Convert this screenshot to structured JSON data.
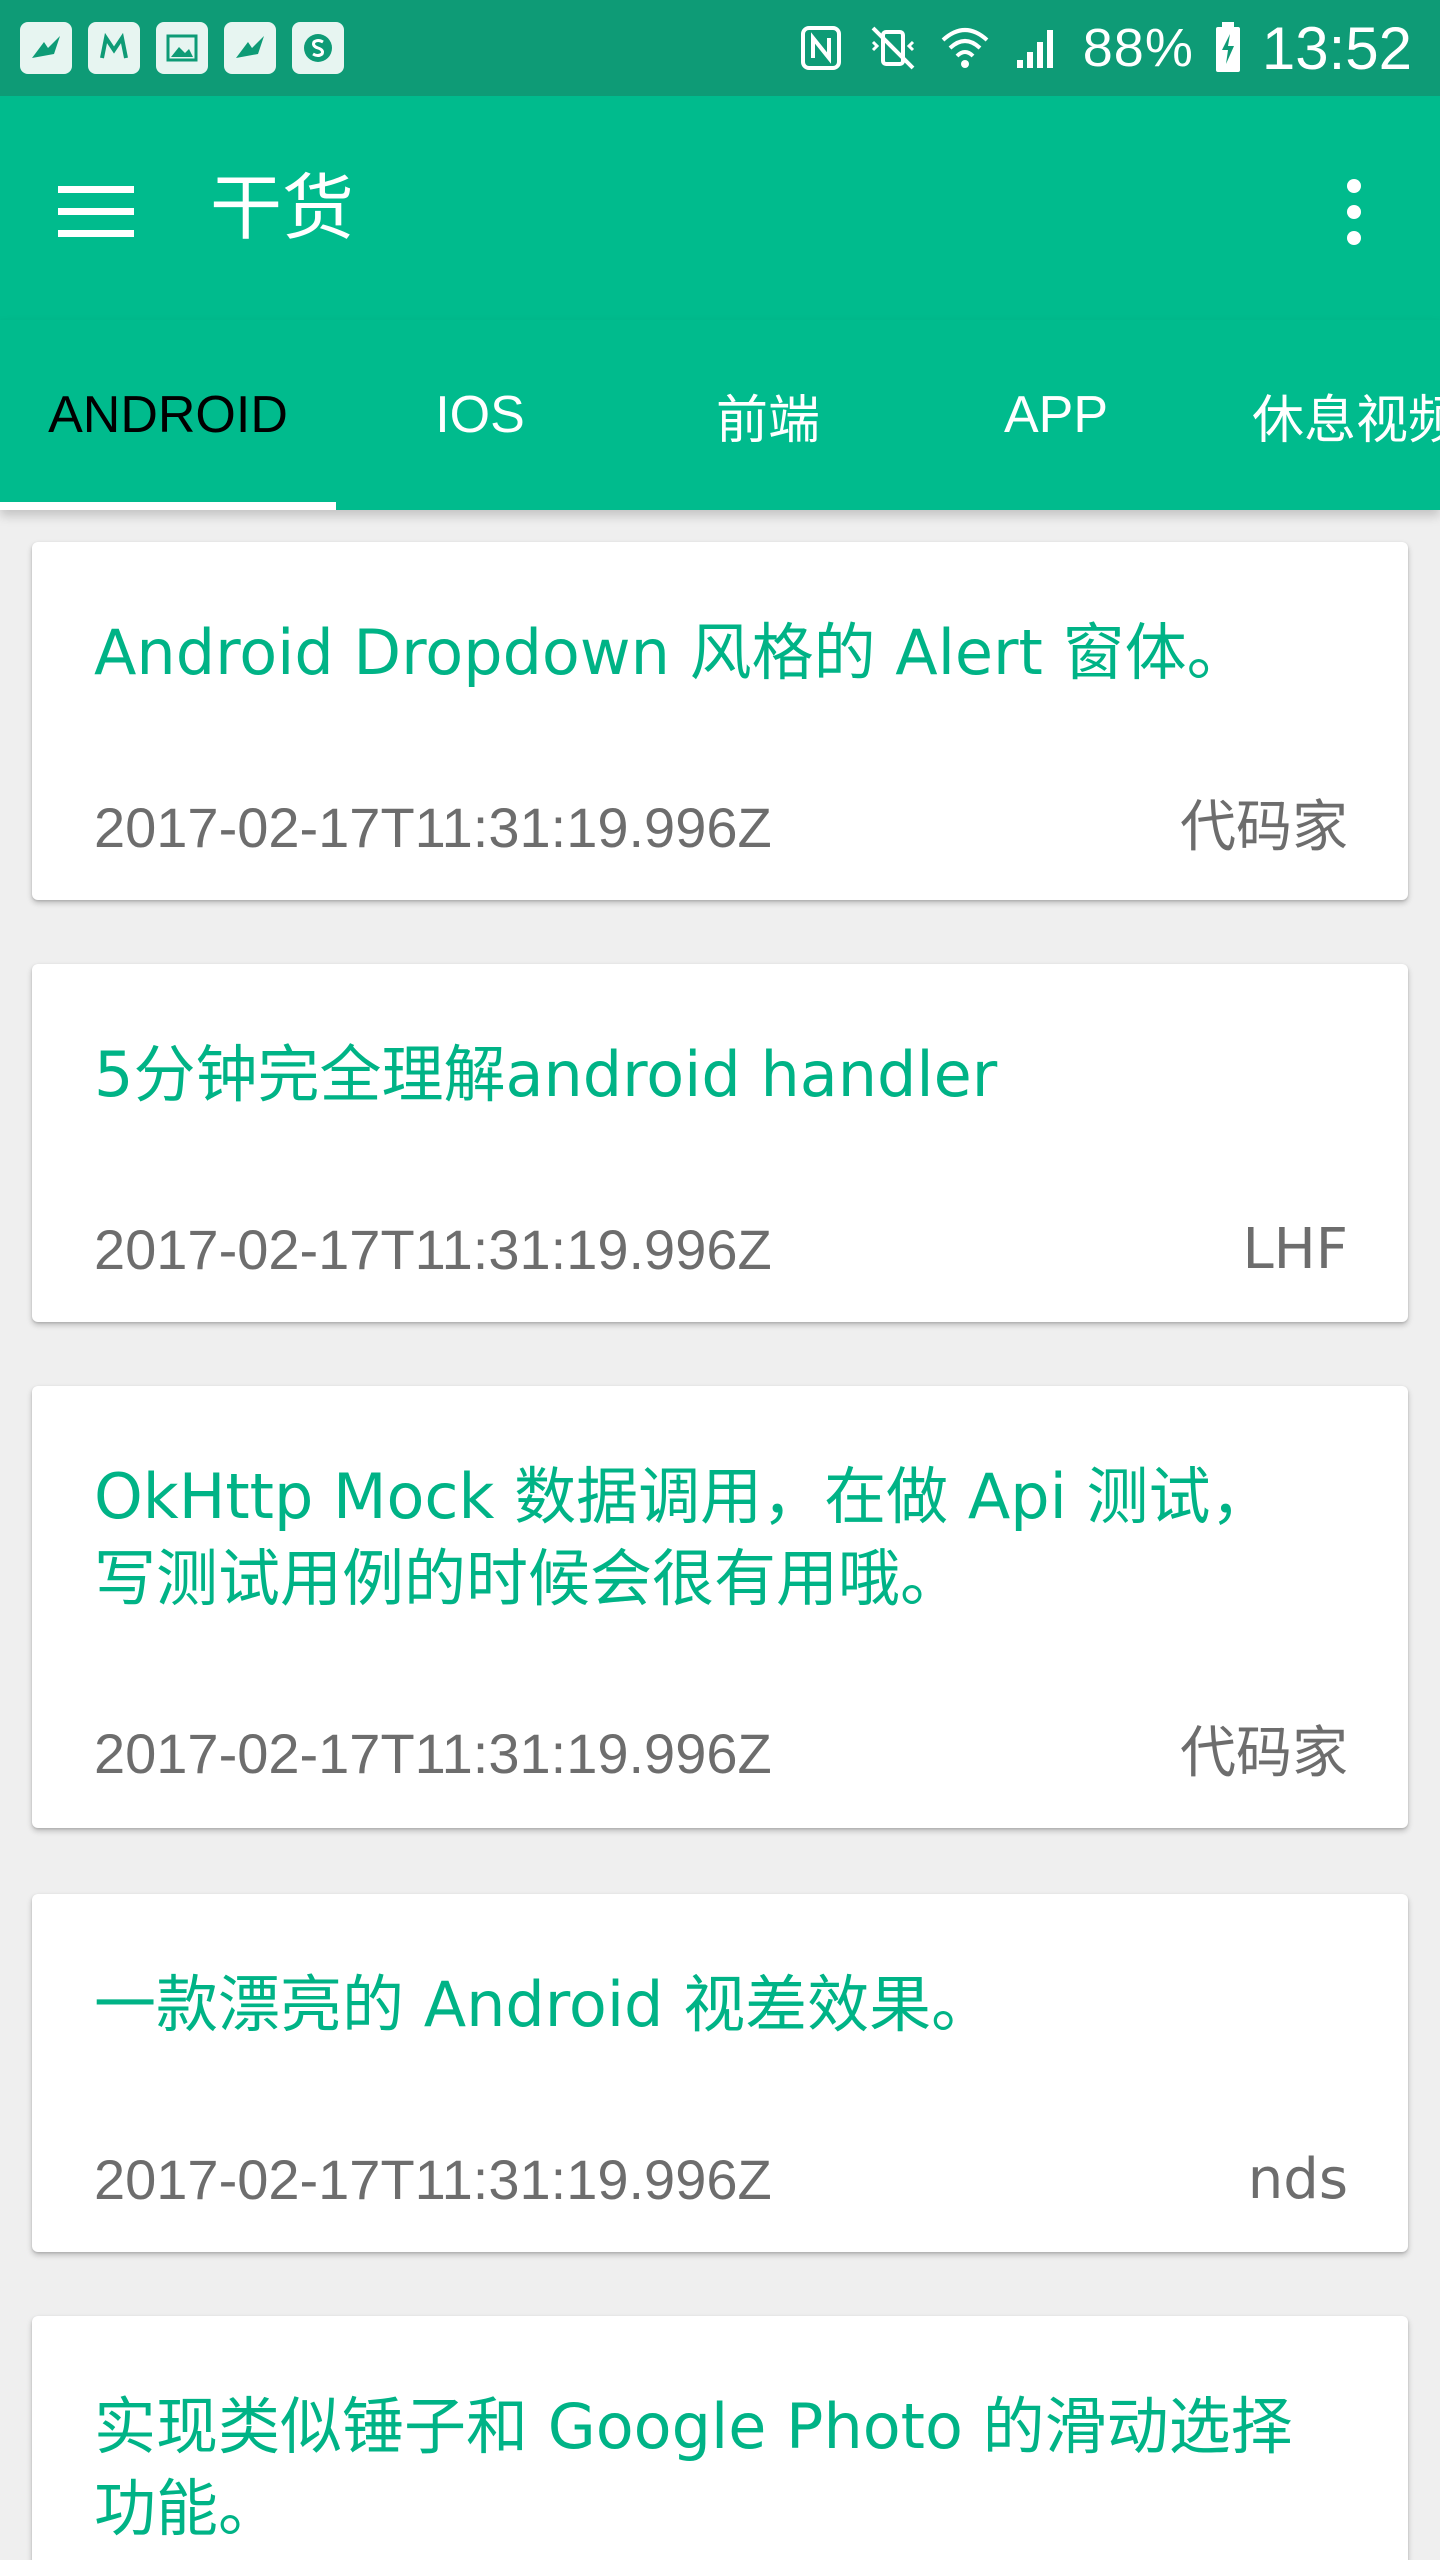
{
  "status_bar": {
    "battery": "88%",
    "time": "13:52",
    "notification_icons": [
      "bird-app-icon",
      "m-app-icon",
      "image-icon",
      "bird-app-icon",
      "s-app-icon"
    ],
    "system_icons": [
      "nfc-icon",
      "mute-vibrate-icon",
      "wifi-icon",
      "signal-icon",
      "battery-charging-icon"
    ]
  },
  "toolbar": {
    "title": "干货",
    "menu_icon": "hamburger-menu-icon",
    "overflow_icon": "more-vert-icon"
  },
  "tabs": [
    {
      "label": "ANDROID",
      "active": true
    },
    {
      "label": "IOS",
      "active": false
    },
    {
      "label": "前端",
      "active": false
    },
    {
      "label": "APP",
      "active": false
    },
    {
      "label": "休息视频",
      "active": false
    }
  ],
  "articles": [
    {
      "title": "Android Dropdown 风格的 Alert 窗体。",
      "date": "2017-02-17T11:31:19.996Z",
      "author": "代码家"
    },
    {
      "title": "5分钟完全理解android handler",
      "date": "2017-02-17T11:31:19.996Z",
      "author": "LHF"
    },
    {
      "title": "OkHttp Mock 数据调用，在做 Api 测试，写测试用例的时候会很有用哦。",
      "date": "2017-02-17T11:31:19.996Z",
      "author": "代码家"
    },
    {
      "title": "一款漂亮的 Android 视差效果。",
      "date": "2017-02-17T11:31:19.996Z",
      "author": "nds"
    },
    {
      "title": "实现类似锤子和 Google Photo 的滑动选择功能。",
      "date": "",
      "author": ""
    }
  ],
  "colors": {
    "primary": "#00bb8d",
    "primary_dark": "#0e9b76",
    "accent_text": "#00b386",
    "secondary_text": "#6d6d6d",
    "background": "#efefef"
  }
}
